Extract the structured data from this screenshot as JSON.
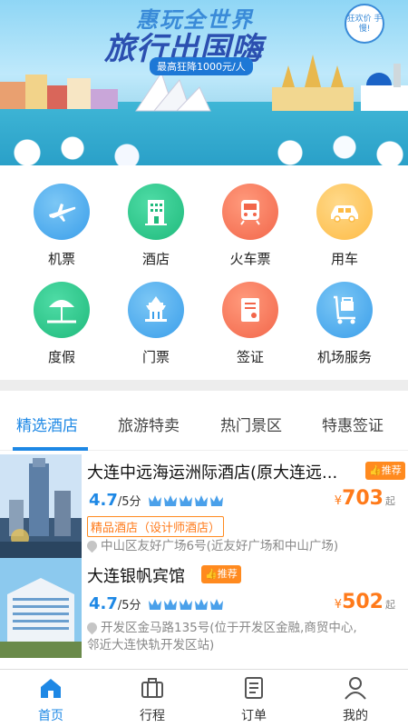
{
  "banner": {
    "line1": "惠玩全世界",
    "line2": "旅行出国嗨",
    "promo": "最高狂降1000元/人",
    "badge": "狂欢价 手慢!"
  },
  "services": [
    {
      "label": "机票",
      "icon": "airplane-icon"
    },
    {
      "label": "酒店",
      "icon": "hotel-building-icon"
    },
    {
      "label": "火车票",
      "icon": "train-icon"
    },
    {
      "label": "用车",
      "icon": "car-icon"
    },
    {
      "label": "度假",
      "icon": "beach-umbrella-icon"
    },
    {
      "label": "门票",
      "icon": "temple-icon"
    },
    {
      "label": "签证",
      "icon": "visa-document-icon"
    },
    {
      "label": "机场服务",
      "icon": "luggage-cart-icon"
    }
  ],
  "tabs": [
    {
      "label": "精选酒店",
      "active": true
    },
    {
      "label": "旅游特卖",
      "active": false
    },
    {
      "label": "热门景区",
      "active": false
    },
    {
      "label": "特惠签证",
      "active": false
    }
  ],
  "hotels": [
    {
      "name": "大连中远海运洲际酒店(原大连远...",
      "recommend": "推荐",
      "rating": "4.7",
      "rating_suffix": "/5分",
      "stars": 5,
      "currency": "¥",
      "price": "703",
      "price_suffix": "起",
      "tag": "精品酒店（设计师酒店）",
      "address": "中山区友好广场6号(近友好广场和中山广场)"
    },
    {
      "name": "大连银帆宾馆",
      "recommend": "推荐",
      "rating": "4.7",
      "rating_suffix": "/5分",
      "stars": 5,
      "currency": "¥",
      "price": "502",
      "price_suffix": "起",
      "address_line1": "开发区金马路135号(位于开发区金融,商贸中心,",
      "address_line2": "邻近大连快轨开发区站)"
    }
  ],
  "nav": [
    {
      "label": "首页",
      "icon": "home-icon",
      "active": true
    },
    {
      "label": "行程",
      "icon": "suitcase-icon",
      "active": false
    },
    {
      "label": "订单",
      "icon": "order-list-icon",
      "active": false
    },
    {
      "label": "我的",
      "icon": "user-icon",
      "active": false
    }
  ],
  "colors": {
    "accent": "#1e88e5",
    "price": "#ff7a1a",
    "recommend": "#ff8a1f"
  }
}
